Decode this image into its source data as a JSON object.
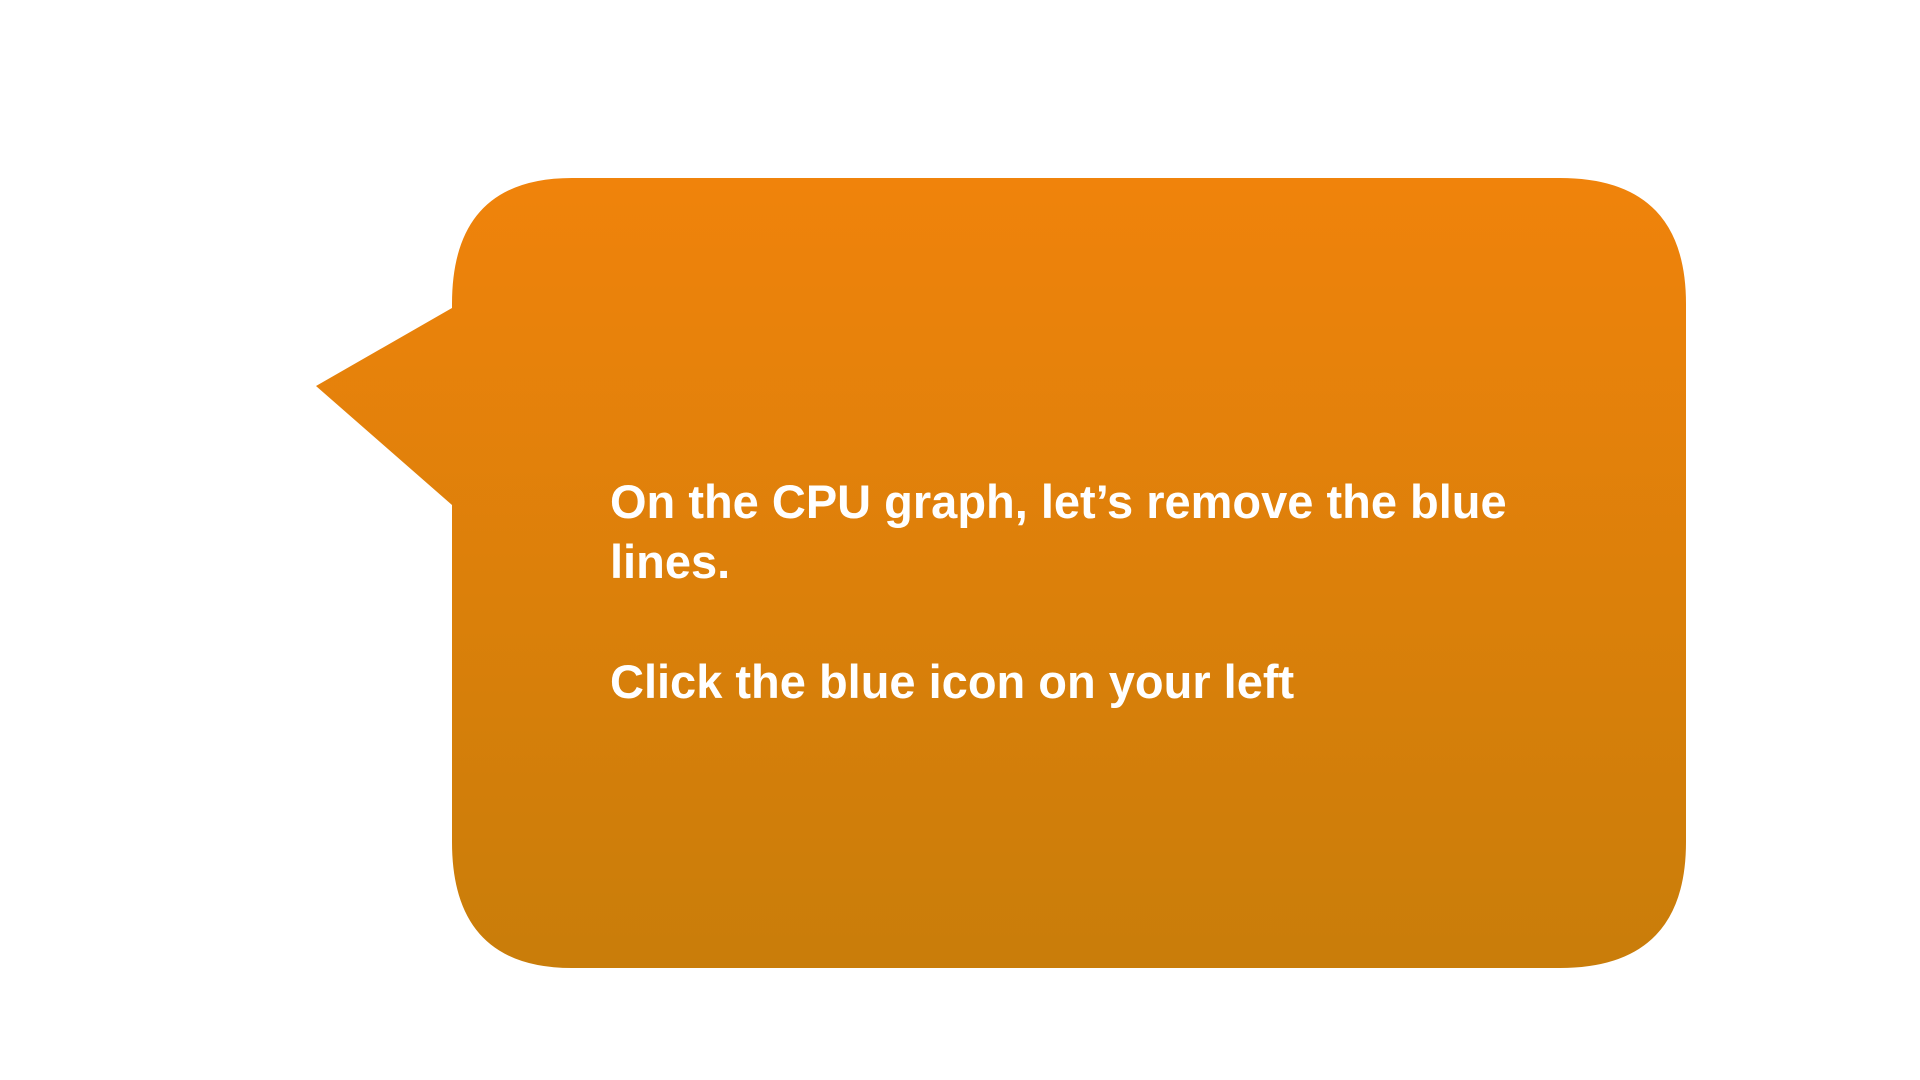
{
  "callout": {
    "line1": "On the CPU graph, let’s remove the blue lines.",
    "line2": "Click the blue icon on your left",
    "pointer_direction": "left",
    "colors": {
      "gradient_top": "#F0830B",
      "gradient_bottom": "#C97D0A",
      "text": "#FFFFFF",
      "background": "#FFFFFF"
    }
  }
}
